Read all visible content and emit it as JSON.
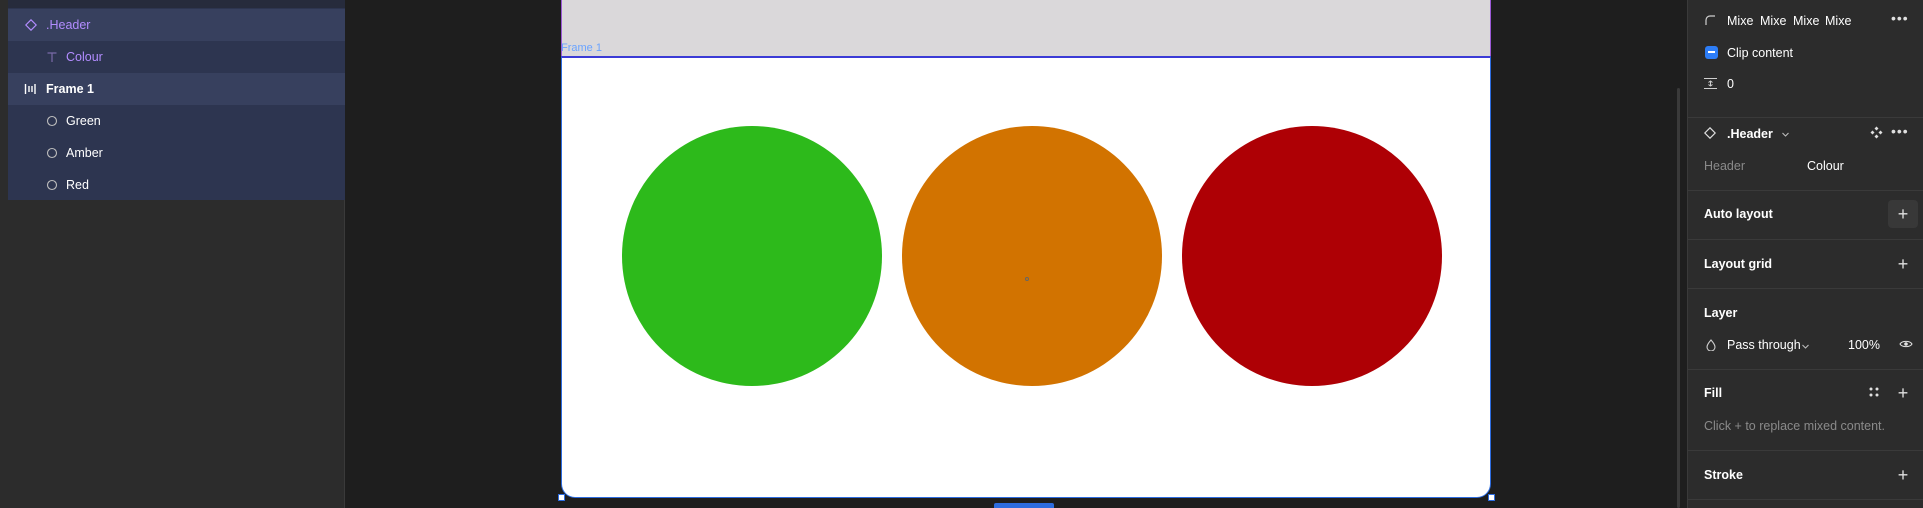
{
  "layers": [
    {
      "label": ".Header",
      "icon": "component-icon",
      "selected": true,
      "color": "#b28cff"
    },
    {
      "label": "Colour",
      "icon": "text-icon",
      "selected": false,
      "color": "#b28cff"
    },
    {
      "label": "Frame 1",
      "icon": "auto-layout-frame-icon",
      "selected": true,
      "color": "#ffffff"
    },
    {
      "label": "Green",
      "icon": "ellipse-icon",
      "selected": false,
      "color": "#ffffff"
    },
    {
      "label": "Amber",
      "icon": "ellipse-icon",
      "selected": false,
      "color": "#ffffff"
    },
    {
      "label": "Red",
      "icon": "ellipse-icon",
      "selected": false,
      "color": "#ffffff"
    }
  ],
  "canvas": {
    "frame_label": "Frame 1",
    "circles": [
      {
        "name": "Green",
        "color": "#2dba1b"
      },
      {
        "name": "Amber",
        "color": "#d27300"
      },
      {
        "name": "Red",
        "color": "#ae0005"
      }
    ]
  },
  "props": {
    "radius_values": [
      "Mixe",
      "Mixe",
      "Mixe",
      "Mixe"
    ],
    "clip_content": "Clip content",
    "spacing_value": "0",
    "component_name": ".Header",
    "prop_name": "Header",
    "prop_value": "Colour",
    "auto_layout": "Auto layout",
    "layout_grid": "Layout grid",
    "layer": "Layer",
    "blend_mode": "Pass through",
    "opacity": "100%",
    "fill": "Fill",
    "fill_hint": "Click + to replace mixed content.",
    "stroke": "Stroke"
  }
}
